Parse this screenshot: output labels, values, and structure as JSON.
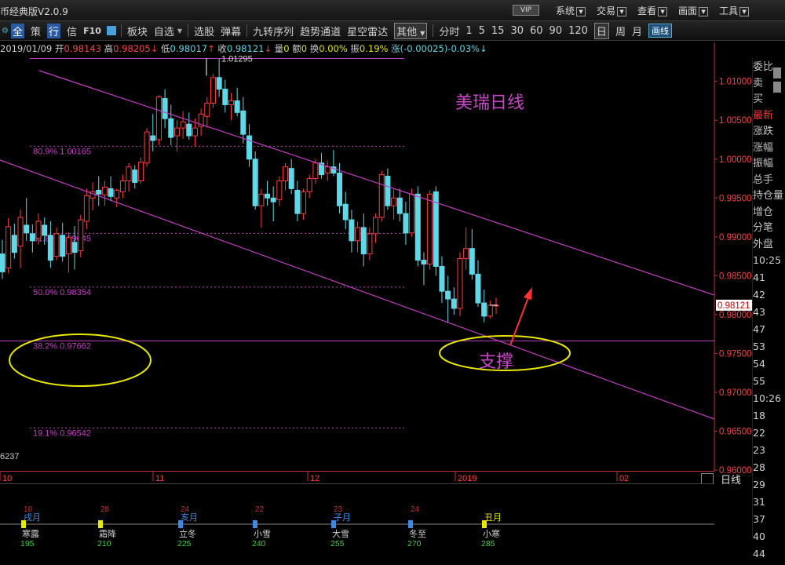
{
  "titlebar": {
    "title": "币经典版V2.0.9",
    "vip_badge": "VIP",
    "menu": [
      "系统",
      "交易",
      "查看",
      "画面",
      "工具"
    ]
  },
  "toolbar": {
    "items": [
      "全",
      "策",
      "行",
      "信",
      "F10",
      "板块",
      "自选",
      "选股",
      "弹幕",
      "九转序列",
      "趋势通道",
      "星空雷达",
      "其他",
      "分时",
      "1",
      "5",
      "15",
      "30",
      "60",
      "90",
      "120",
      "日",
      "周",
      "月",
      "画线"
    ]
  },
  "info_bar": {
    "date": "2019/01/09",
    "open_label": "开",
    "open": "0.98143",
    "high_label": "高",
    "high": "0.98205",
    "low_label": "低",
    "low": "0.98017",
    "close_label": "收",
    "close": "0.98121",
    "volume_label": "量",
    "volume": "0",
    "amount_label": "额",
    "amount": "0",
    "turnover_label": "换",
    "turnover": "0.00%",
    "amplitude_label": "振",
    "amplitude": "0.19%",
    "change_label": "涨",
    "change": "(-0.00025)-0.03%"
  },
  "chart_data": {
    "type": "candlestick",
    "title": "美瑞日线",
    "annotation": "支撑",
    "peak_label": "1.01295",
    "current_price_label": "0.98121",
    "left_value_label": "6237",
    "ylim": [
      0.96,
      1.013
    ],
    "y_ticks": [
      "1.01000",
      "1.00500",
      "1.00000",
      "0.99500",
      "0.99000",
      "0.98500",
      "0.98000",
      "0.97500",
      "0.97000",
      "0.96500",
      "0.96000"
    ],
    "x_ticks": [
      "10",
      "11",
      "12",
      "2019",
      "02"
    ],
    "fib_levels": [
      {
        "label": "80.9%",
        "value": "1.00165"
      },
      {
        "label": "61.8%",
        "value": "0.99045"
      },
      {
        "label": "50.0%",
        "value": "0.98354"
      },
      {
        "label": "38.2%",
        "value": "0.97662"
      },
      {
        "label": "19.1%",
        "value": "0.96542"
      }
    ],
    "colors": {
      "up": "#ff3c3c",
      "down": "#5fd8e8",
      "channel": "#c040c0",
      "fib": "#c040c0",
      "ellipse": "#e8e800",
      "arrow": "#ff3232"
    },
    "candles": [
      [
        0.9878,
        0.9896,
        0.9846,
        0.9855
      ],
      [
        0.986,
        0.9924,
        0.9853,
        0.9913
      ],
      [
        0.9902,
        0.9917,
        0.9872,
        0.988
      ],
      [
        0.9888,
        0.9935,
        0.986,
        0.9925
      ],
      [
        0.9915,
        0.995,
        0.9895,
        0.9905
      ],
      [
        0.9904,
        0.9916,
        0.988,
        0.9895
      ],
      [
        0.9898,
        0.993,
        0.989,
        0.992
      ],
      [
        0.9915,
        0.9925,
        0.989,
        0.9902
      ],
      [
        0.9902,
        0.992,
        0.986,
        0.987
      ],
      [
        0.9875,
        0.9912,
        0.987,
        0.9904
      ],
      [
        0.9902,
        0.9918,
        0.9868,
        0.9875
      ],
      [
        0.9878,
        0.9906,
        0.9854,
        0.9899
      ],
      [
        0.9893,
        0.9914,
        0.9858,
        0.988
      ],
      [
        0.9882,
        0.9928,
        0.9874,
        0.9922
      ],
      [
        0.992,
        0.9962,
        0.991,
        0.9953
      ],
      [
        0.995,
        0.997,
        0.9934,
        0.9958
      ],
      [
        0.996,
        0.9978,
        0.994,
        0.9955
      ],
      [
        0.9954,
        0.9972,
        0.994,
        0.9964
      ],
      [
        0.9962,
        0.9978,
        0.9946,
        0.9952
      ],
      [
        0.995,
        0.9962,
        0.9938,
        0.996
      ],
      [
        0.9958,
        0.998,
        0.995,
        0.9972
      ],
      [
        0.9972,
        0.9995,
        0.9958,
        0.999
      ],
      [
        0.9986,
        0.9992,
        0.9962,
        0.997
      ],
      [
        0.9972,
        1.0002,
        0.9968,
        0.9996
      ],
      [
        0.9995,
        1.004,
        0.999,
        1.0035
      ],
      [
        1.003,
        1.0058,
        1.001,
        1.0024
      ],
      [
        1.0025,
        1.0082,
        1.0018,
        1.008
      ],
      [
        1.0078,
        1.009,
        1.004,
        1.0052
      ],
      [
        1.0052,
        1.007,
        1.0018,
        1.0028
      ],
      [
        1.003,
        1.005,
        1.001,
        1.004
      ],
      [
        1.004,
        1.0062,
        1.0026,
        1.0048
      ],
      [
        1.0045,
        1.006,
        1.0025,
        1.003
      ],
      [
        1.003,
        1.0052,
        1.0016,
        1.004
      ],
      [
        1.0042,
        1.0065,
        1.003,
        1.0058
      ],
      [
        1.0055,
        1.008,
        1.004,
        1.0072
      ],
      [
        1.0072,
        1.011,
        1.0066,
        1.0105
      ],
      [
        1.0105,
        1.0129,
        1.008,
        1.009
      ],
      [
        1.009,
        1.0102,
        1.006,
        1.007
      ],
      [
        1.007,
        1.0085,
        1.005,
        1.0075
      ],
      [
        1.0075,
        1.0092,
        1.0055,
        1.006
      ],
      [
        1.0062,
        1.008,
        1.002,
        1.0032
      ],
      [
        1.003,
        1.0045,
        0.999,
        1.0
      ],
      [
        1.0,
        1.001,
        0.9935,
        0.994
      ],
      [
        0.994,
        0.9962,
        0.9912,
        0.9955
      ],
      [
        0.9955,
        0.9972,
        0.994,
        0.995
      ],
      [
        0.995,
        0.9965,
        0.992,
        0.9945
      ],
      [
        0.9948,
        0.9978,
        0.994,
        0.9972
      ],
      [
        0.9972,
        0.9995,
        0.996,
        0.999
      ],
      [
        0.9988,
        1.0,
        0.9955,
        0.9962
      ],
      [
        0.996,
        0.9972,
        0.992,
        0.993
      ],
      [
        0.993,
        0.9962,
        0.9922,
        0.9958
      ],
      [
        0.9958,
        0.998,
        0.995,
        0.9975
      ],
      [
        0.9975,
        1.0,
        0.9968,
        0.9995
      ],
      [
        0.9995,
        1.0008,
        0.9975,
        0.998
      ],
      [
        0.9982,
        0.9998,
        0.9972,
        0.999
      ],
      [
        0.999,
        1.0012,
        0.9978,
        0.9982
      ],
      [
        0.9982,
        0.9995,
        0.993,
        0.994
      ],
      [
        0.9942,
        0.9958,
        0.991,
        0.9922
      ],
      [
        0.9922,
        0.9935,
        0.988,
        0.9895
      ],
      [
        0.9895,
        0.992,
        0.988,
        0.9912
      ],
      [
        0.9912,
        0.993,
        0.9862,
        0.9878
      ],
      [
        0.9878,
        0.9912,
        0.987,
        0.9904
      ],
      [
        0.9904,
        0.993,
        0.9892,
        0.9925
      ],
      [
        0.9925,
        0.9985,
        0.992,
        0.998
      ],
      [
        0.9978,
        0.9988,
        0.9935,
        0.994
      ],
      [
        0.994,
        0.9962,
        0.9922,
        0.995
      ],
      [
        0.995,
        0.9962,
        0.992,
        0.993
      ],
      [
        0.993,
        0.9945,
        0.989,
        0.9905
      ],
      [
        0.9905,
        0.9962,
        0.99,
        0.9955
      ],
      [
        0.9955,
        0.9965,
        0.9862,
        0.987
      ],
      [
        0.987,
        0.988,
        0.9838,
        0.9865
      ],
      [
        0.9865,
        0.996,
        0.9858,
        0.9955
      ],
      [
        0.9958,
        0.9965,
        0.985,
        0.9862
      ],
      [
        0.9862,
        0.9875,
        0.9815,
        0.983
      ],
      [
        0.983,
        0.985,
        0.979,
        0.982
      ],
      [
        0.982,
        0.9835,
        0.98,
        0.9808
      ],
      [
        0.9808,
        0.988,
        0.9798,
        0.9872
      ],
      [
        0.9872,
        0.9912,
        0.9858,
        0.9885
      ],
      [
        0.9885,
        0.991,
        0.9845,
        0.9852
      ],
      [
        0.9852,
        0.987,
        0.981,
        0.9815
      ],
      [
        0.9815,
        0.9832,
        0.979,
        0.9798
      ],
      [
        0.9798,
        0.9818,
        0.9795,
        0.9812
      ],
      [
        0.9812,
        0.9822,
        0.9801,
        0.9812
      ]
    ]
  },
  "right_panel": {
    "labels": [
      "委比",
      "卖",
      "买",
      "最新",
      "涨跌",
      "涨幅",
      "振幅",
      "总手",
      "持仓量",
      "增仓",
      "分笔",
      "外盘"
    ],
    "times": [
      "10:25",
      "41",
      "42",
      "43",
      "47",
      "53",
      "54",
      "55",
      "10:26",
      "18",
      "22",
      "23",
      "28",
      "29",
      "31",
      "37",
      "40",
      "44"
    ]
  },
  "bottom_panel": {
    "period_button": "日线",
    "terms": [
      {
        "day": "18",
        "month": "戌月",
        "term": "寒露",
        "num": "195"
      },
      {
        "day": "28",
        "month": "",
        "term": "霜降",
        "num": "210"
      },
      {
        "day": "24",
        "month": "亥月",
        "term": "立冬",
        "num": "225"
      },
      {
        "day": "22",
        "month": "",
        "term": "小雪",
        "num": "240"
      },
      {
        "day": "23",
        "month": "子月",
        "term": "大雪",
        "num": "255"
      },
      {
        "day": "24",
        "month": "",
        "term": "冬至",
        "num": "270"
      },
      {
        "day": "",
        "month": "丑月",
        "term": "小寒",
        "num": "285"
      }
    ]
  }
}
